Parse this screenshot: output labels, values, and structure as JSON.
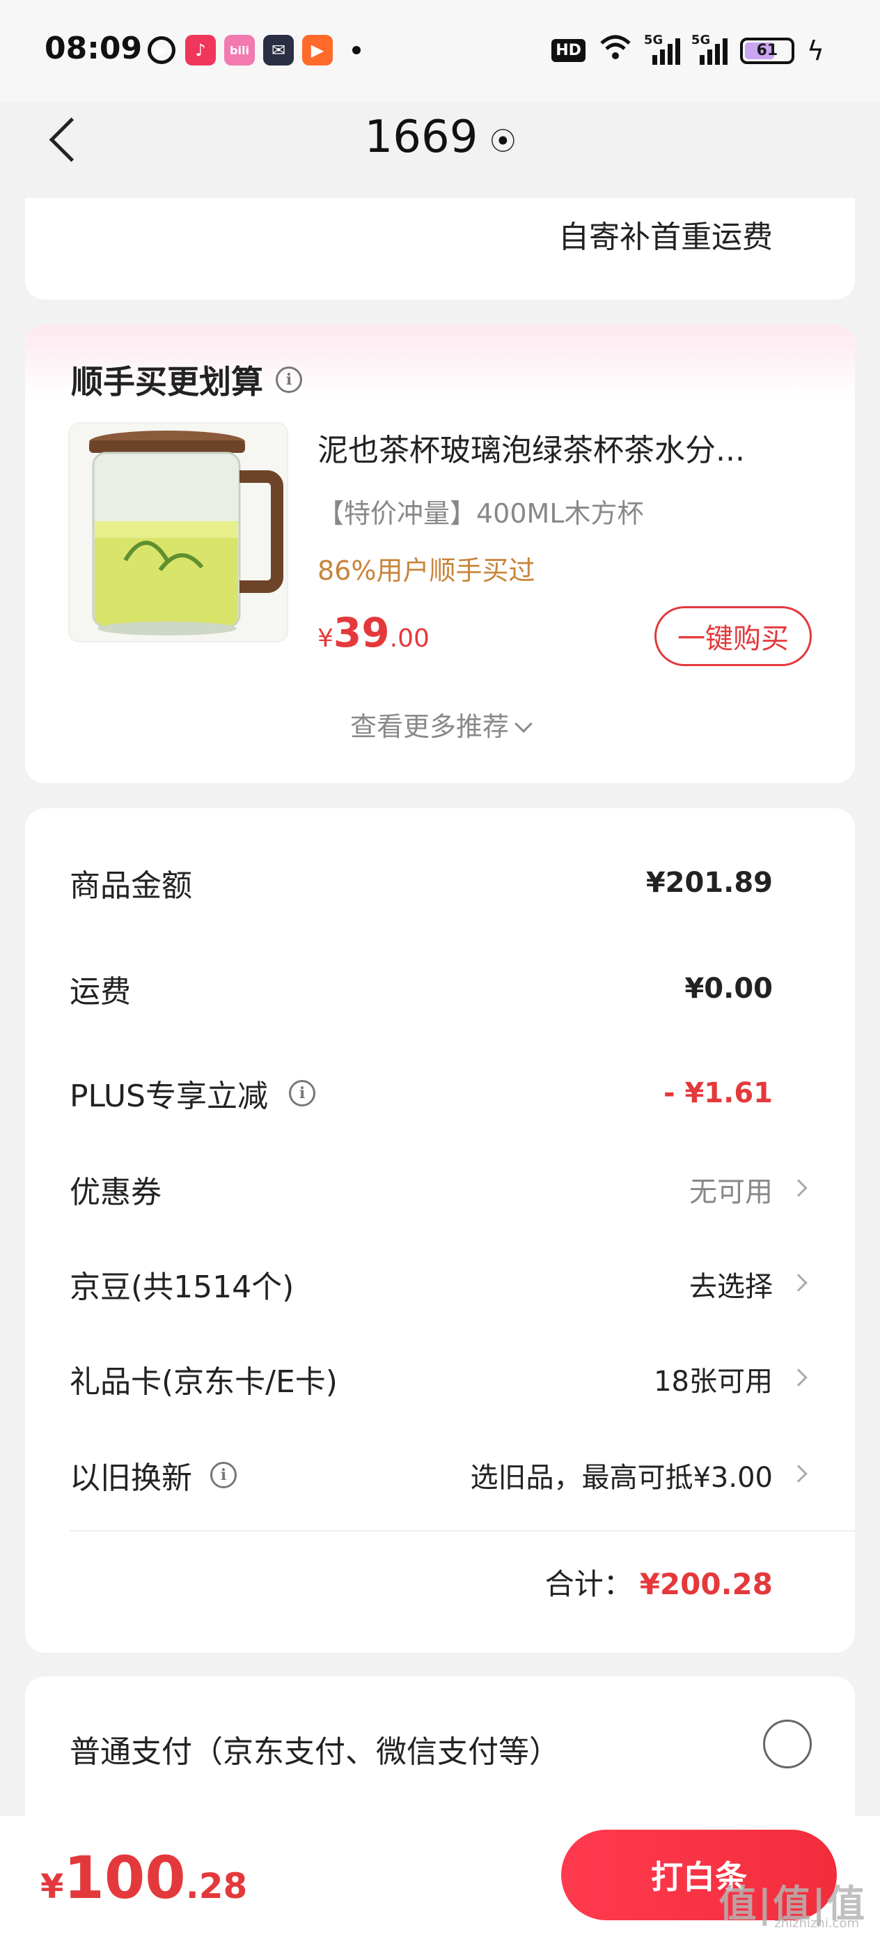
{
  "status_bar": {
    "time": "08:09",
    "hd_label": "HD",
    "signal_label": "5G",
    "battery": "61",
    "battery_level_percent": 61
  },
  "header": {
    "title": "1669"
  },
  "shipping_card": {
    "text": "自寄补首重运费"
  },
  "recommend": {
    "title": "顺手买更划算",
    "product_name": "泥也茶杯玻璃泡绿茶杯茶水分...",
    "spec": "【特价冲量】400ML木方杯",
    "note": "86%用户顺手买过",
    "price_symbol": "¥",
    "price_int": "39",
    "price_dec": ".00",
    "buy_button": "一键购买",
    "more_link": "查看更多推荐"
  },
  "summary": {
    "rows": [
      {
        "label": "商品金额",
        "value": "¥201.89"
      },
      {
        "label": "运费",
        "value": "¥0.00"
      },
      {
        "label": "PLUS专享立减",
        "value": "- ¥1.61"
      },
      {
        "label": "优惠券",
        "value": "无可用"
      },
      {
        "label": "京豆(共1514个)",
        "value": "去选择"
      },
      {
        "label": "礼品卡(京东卡/E卡)",
        "value": "18张可用"
      },
      {
        "label": "以旧换新",
        "value": "选旧品，最高可抵¥3.00"
      }
    ],
    "total_label": "合计：",
    "total_value": "¥200.28"
  },
  "payment": {
    "option_label": "普通支付（京东支付、微信支付等）"
  },
  "bottom_bar": {
    "price_symbol": "¥",
    "price_int": "100",
    "price_dec": ".28",
    "pay_button": "打白条"
  },
  "watermark": {
    "text": "值|值|值",
    "sub": "zhizhizhi.com"
  },
  "colors": {
    "accent_red": "#e4393c",
    "note_orange": "#c8843b"
  }
}
